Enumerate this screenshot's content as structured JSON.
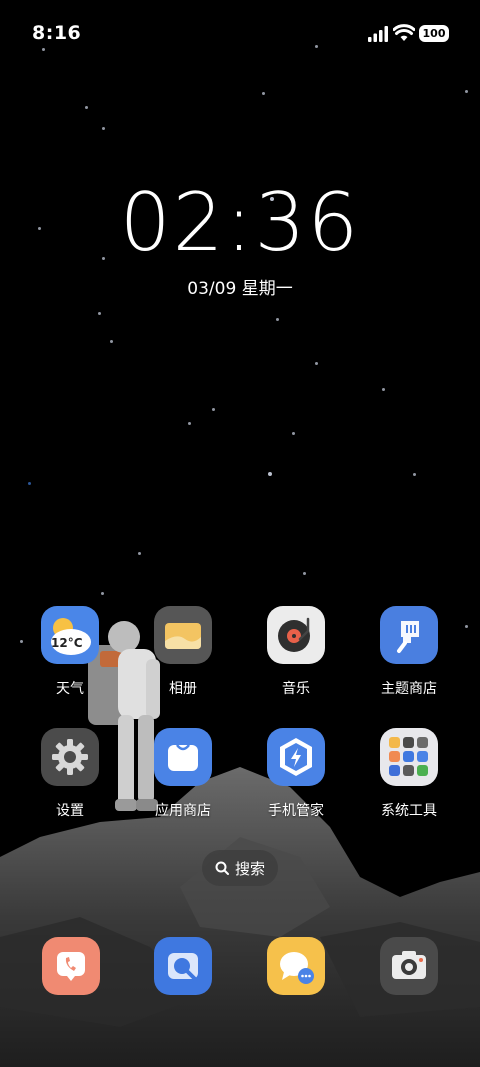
{
  "status_bar": {
    "time": "8:16",
    "battery": "100",
    "icons": [
      "signal-icon",
      "wifi-icon",
      "battery-icon"
    ]
  },
  "clock_widget": {
    "time": "02:36",
    "date": "03/09 星期一"
  },
  "apps_row1": [
    {
      "label": "天气",
      "icon": "weather-icon",
      "badge": "12°C",
      "color": "#4a86e8"
    },
    {
      "label": "相册",
      "icon": "gallery-icon",
      "color": "#565656"
    },
    {
      "label": "音乐",
      "icon": "music-icon",
      "color": "#ececec"
    },
    {
      "label": "主题商店",
      "icon": "theme-store-icon",
      "color": "#4a7fe0"
    }
  ],
  "apps_row2": [
    {
      "label": "设置",
      "icon": "settings-icon",
      "color": "#4b4b4b"
    },
    {
      "label": "应用商店",
      "icon": "app-store-icon",
      "color": "#4a83e6"
    },
    {
      "label": "手机管家",
      "icon": "phone-manager-icon",
      "color": "#4a83e6"
    },
    {
      "label": "系统工具",
      "icon": "folder-icon",
      "color": "#e8e8ec"
    }
  ],
  "search": {
    "label": "搜索"
  },
  "dock": [
    {
      "icon": "phone-icon",
      "color": "#f08a72"
    },
    {
      "icon": "browser-icon",
      "color": "#3f78e0"
    },
    {
      "icon": "messages-icon",
      "color": "#f6c14b"
    },
    {
      "icon": "camera-icon",
      "color": "#4a4a4a"
    }
  ]
}
